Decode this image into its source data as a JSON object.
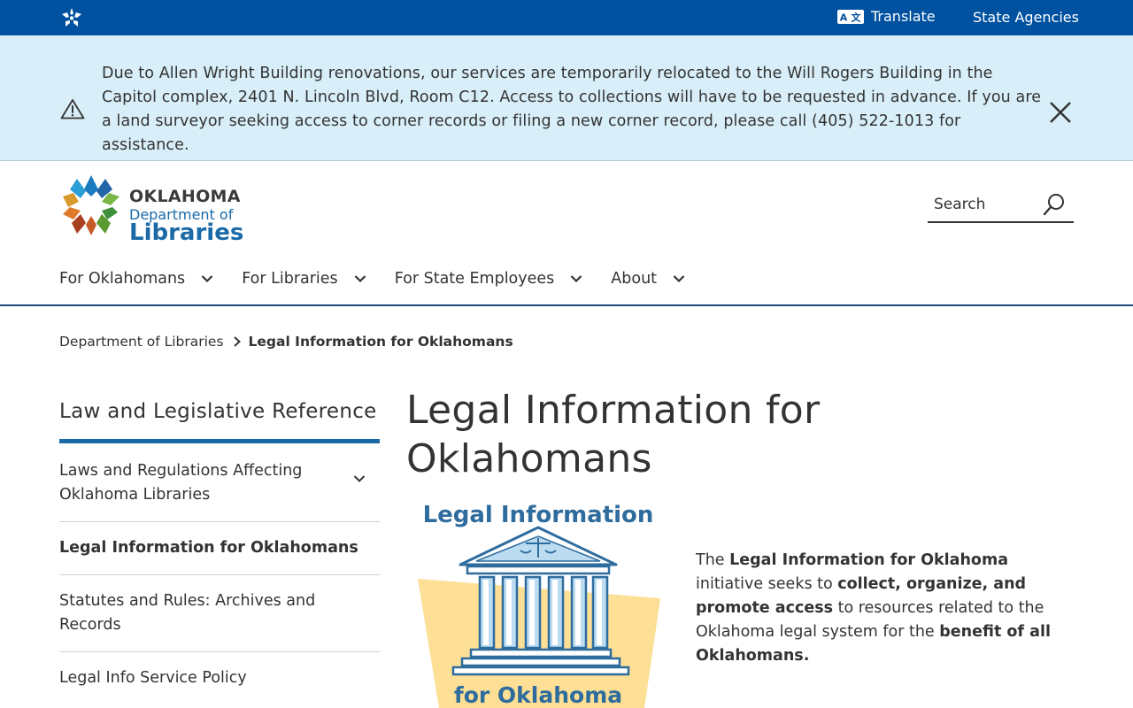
{
  "topbar": {
    "translate_label": "Translate",
    "agencies_label": "State Agencies",
    "colors": {
      "background": "#0051a0"
    }
  },
  "alert": {
    "text": "Due to Allen Wright Building renovations, our services are temporarily relocated to the Will Rogers Building in the Capitol complex, 2401 N. Lincoln Blvd, Room C12. Access to collections will have to be requested in advance. If you are a land surveyor seeking access to corner records or filing a new corner record, please call (405) 522-1013 for assistance.",
    "colors": {
      "background": "#d8eef8"
    }
  },
  "logo": {
    "line1": "OKLAHOMA",
    "line2": "Department of",
    "line3": "Libraries"
  },
  "search": {
    "placeholder": "Search"
  },
  "nav": {
    "items": [
      {
        "label": "For Oklahomans"
      },
      {
        "label": "For Libraries"
      },
      {
        "label": "For State Employees"
      },
      {
        "label": "About"
      }
    ]
  },
  "breadcrumb": {
    "parent": "Department of Libraries",
    "current": "Legal Information for Oklahomans"
  },
  "sidebar": {
    "title": "Law and Legislative Reference",
    "items": [
      {
        "label": "Laws and Regulations Affecting Oklahoma Libraries"
      },
      {
        "label": "Legal Information for Oklahomans"
      },
      {
        "label": "Statutes and Rules: Archives and Records"
      },
      {
        "label": "Legal Info Service Policy"
      }
    ]
  },
  "main": {
    "title": "Legal Information for Oklahomans",
    "graphic": {
      "top_text": "Legal Information",
      "bottom_text": "for Oklahoma"
    },
    "intro": {
      "p1": "The ",
      "b1": "Legal Information for Oklahoma",
      "p2": " initiative seeks to ",
      "b2": "collect, organize, and promote access",
      "p3": " to resources related to the Oklahoma legal system for the ",
      "b3": "benefit of all Oklahomans."
    }
  },
  "colors": {
    "accent": "#1a6aa8",
    "nav_border": "#1f4d7a",
    "text": "#333333",
    "graphic_blue": "#2f6c9e",
    "graphic_yellow": "#fddf95"
  }
}
